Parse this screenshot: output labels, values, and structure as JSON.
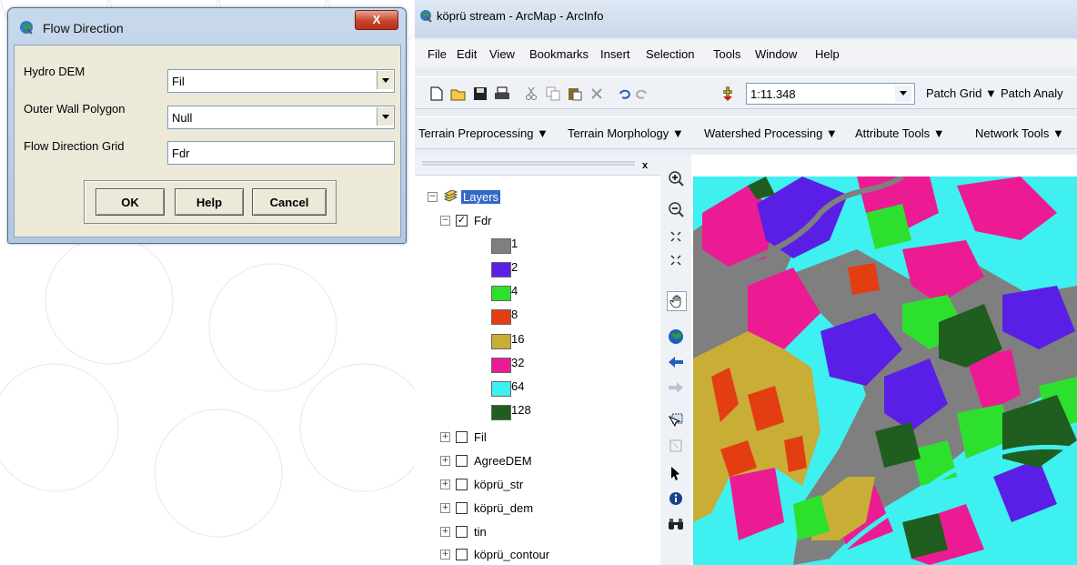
{
  "dialog": {
    "title": "Flow Direction",
    "close_label": "X",
    "fields": [
      {
        "label": "Hydro DEM",
        "value": "Fil"
      },
      {
        "label": "Outer Wall Polygon",
        "value": "Null"
      },
      {
        "label": "Flow Direction Grid",
        "value": "Fdr"
      }
    ],
    "buttons": {
      "ok": "OK",
      "help": "Help",
      "cancel": "Cancel"
    }
  },
  "arcmap": {
    "title": "köprü stream - ArcMap - ArcInfo",
    "menu": [
      "File",
      "Edit",
      "View",
      "Bookmarks",
      "Insert",
      "Selection",
      "Tools",
      "Window",
      "Help"
    ],
    "toolbar": {
      "scale": "1:11.348",
      "patch_grid": "Patch Grid ▼",
      "patch_analysis": "Patch Analy"
    },
    "archydro_toolbar": [
      "Terrain Preprocessing ▼",
      "Terrain Morphology ▼",
      "Watershed Processing ▼",
      "Attribute Tools ▼",
      "Network Tools ▼"
    ],
    "toc": {
      "close": "x",
      "root": "Layers",
      "active_layer": "Fdr",
      "legend": [
        {
          "label": "1",
          "color": "#7f7f7f"
        },
        {
          "label": "2",
          "color": "#5a1fe6"
        },
        {
          "label": "4",
          "color": "#2ee02e"
        },
        {
          "label": "8",
          "color": "#e33d12"
        },
        {
          "label": "16",
          "color": "#c8ad36"
        },
        {
          "label": "32",
          "color": "#ec1b93"
        },
        {
          "label": "64",
          "color": "#3ff0f0"
        },
        {
          "label": "128",
          "color": "#1f5e1f"
        }
      ],
      "layers": [
        "Fil",
        "AgreeDEM",
        "köprü_str",
        "köprü_dem",
        "tin",
        "köprü_contour"
      ]
    }
  },
  "colors": {
    "title_bar": "#c9d7ea",
    "close_button": "#c7452d",
    "selected_layer": "#3368c8"
  },
  "icons": {
    "dialog_app": "globe-icon",
    "arcmap_app": "globe-icon",
    "tools": [
      "zoom-in-icon",
      "zoom-out-icon",
      "fixed-zoom-in-icon",
      "fixed-zoom-out-icon",
      "pan-icon",
      "full-extent-icon",
      "back-icon",
      "forward-icon",
      "select-features-icon",
      "clear-selection-icon",
      "select-elements-icon",
      "identify-icon",
      "find-icon"
    ]
  }
}
